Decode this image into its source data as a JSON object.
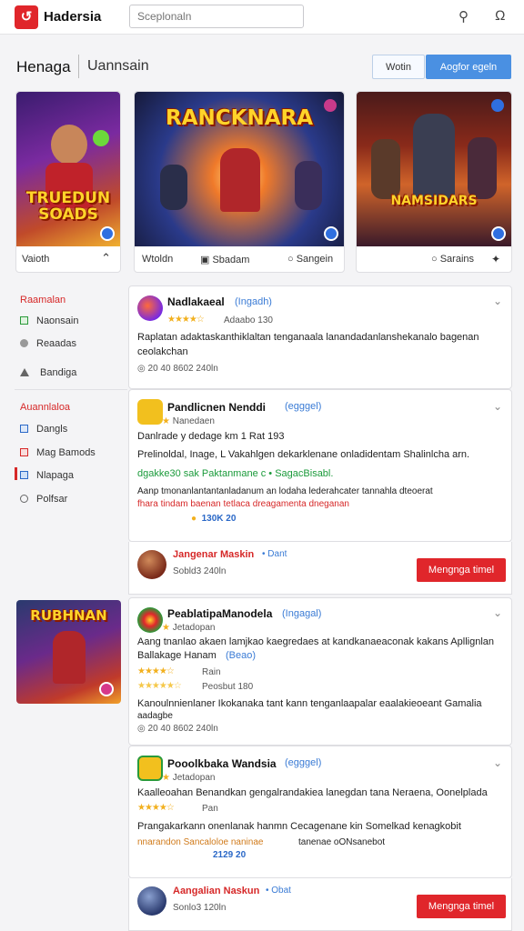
{
  "topbar": {
    "app_name": "Hadersia",
    "search_placeholder": "Sceplonaln"
  },
  "header": {
    "title": "Henaga",
    "subtitle": "Uannsain",
    "btn_secondary": "Wotin",
    "btn_primary": "Aogfor egeln"
  },
  "game_cards": [
    {
      "title": "TRUEDUN SOADS",
      "footer_left": "Vaioth",
      "footer_icon": "chevron-up-icon"
    },
    {
      "title": "RANCKNARA",
      "footer_left": "Wtoldn",
      "footer_mid": "Sbadam",
      "footer_right": "Sangein"
    },
    {
      "title": "NAMSIDARS",
      "footer_right": "Sarains",
      "footer_icon": "grid-icon"
    }
  ],
  "sidebar": {
    "section1": "Raamalan",
    "items1": [
      {
        "label": "Naonsain",
        "icon": "check-icon"
      },
      {
        "label": "Reaadas",
        "icon": "circle-icon"
      },
      {
        "label": "Bandiga",
        "icon": "bell-icon"
      }
    ],
    "section2": "Auannlaloa",
    "items2": [
      {
        "label": "Dangls",
        "icon": "list-icon"
      },
      {
        "label": "Mag Bamods",
        "icon": "mail-icon"
      },
      {
        "label": "Nlapaga",
        "icon": "page-icon"
      },
      {
        "label": "Polfsar",
        "icon": "clock-icon"
      }
    ]
  },
  "feed": [
    {
      "name": "Nadlakaeal",
      "tag": "(Ingadh)",
      "rating_text": "Adaabo 130",
      "line1": "Raplatan adaktaskanthiklaltan tenganaala lanandadanlanshekanalo bagenan",
      "line2": "ceolakchan",
      "meta": "20 40 8602 240ln"
    },
    {
      "name": "Pandlicnen Nenddi",
      "tag": "(egggel)",
      "sub": "Nanedaen",
      "line1": "Danlrade y dedage km 1 Rat 193",
      "line2": "Prelinoldal, Inage, L Vakahlgen  dekarklenane onladidentam Shalinlcha arn.",
      "line3": "dgakke30 sak Paktanmane c • SagacBisabl.",
      "line4": "Aanp tmonanlantantanladanum an lodaha lederahcater tannahla dteoerat",
      "line5": "fhara tindam  baenan tetlaca dreagamenta dneganan",
      "meta_num": "130K 20",
      "sub_name": "Jangenar Maskin",
      "sub_tag": "• Dant",
      "sub_meta": "Sobld3 240ln",
      "sub_button": "Mengnga timel"
    },
    {
      "name": "PeablatipaManodela",
      "tag": "(Ingagal)",
      "sub": "Jetadopan",
      "line1": "Aang tnanlao akaen lamjkao kaegredaes at kandkanaeaconak kakans Apllignlan",
      "line2": "Ballakage Hanam",
      "line2_tag": "(Beao)",
      "rating_text": "Rain",
      "rating2_text": "Peosbut 180",
      "line3": "Kanoulnnienlaner Ikokanaka tant kann tenganlaapalar eaalakieoeant Gamalia",
      "line4": "aadagbe",
      "meta": "20 40 8602 240ln"
    },
    {
      "name": "Pooolkbaka Wandsia",
      "tag": "(egggel)",
      "sub": "Jetadopan",
      "line1": "Kaalleoahan Benandkan gengalrandakiea lanegdan tana Neraena, Oonelplada",
      "rating_text": "Pan",
      "line2": "Prangakarkann onenlanak hanmn Cecagenane kin Somelkad kenagkobit",
      "line3": "nnarandon   Sancaloloe naninae",
      "line3b": "tanenae oONsanebot",
      "meta_num": "2129 20",
      "sub_name": "Aangalian Naskun",
      "sub_tag": "• Obat",
      "sub_meta": "Sonlo3 120ln",
      "sub_button": "Mengnga timel"
    }
  ],
  "thumb_title": "RUBHNAN"
}
